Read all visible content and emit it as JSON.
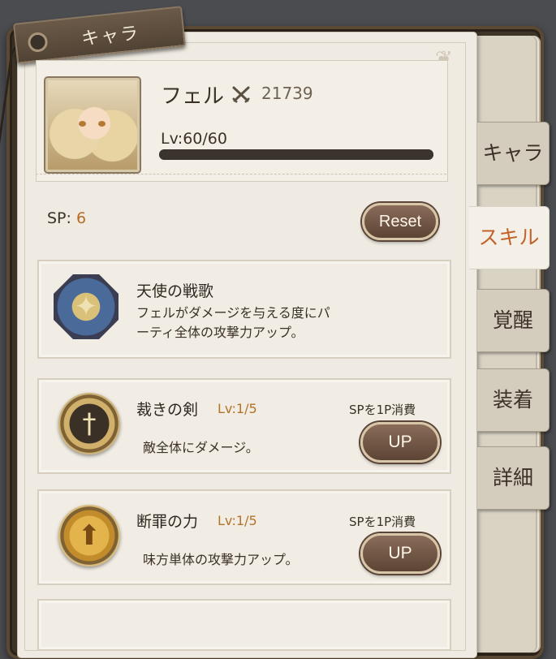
{
  "header": {
    "title": "キャラ"
  },
  "character": {
    "name": "フェル",
    "power": "21739",
    "level_text": "Lv:60/60",
    "level_progress": 1.0
  },
  "sp": {
    "label": "SP: ",
    "value": "6"
  },
  "reset_label": "Reset",
  "skills": [
    {
      "title": "天使の戦歌",
      "desc_line1": "フェルがダメージを与える度にパ",
      "desc_line2": "ーティ全体の攻撃力アップ。",
      "icon": "angel-song-icon"
    },
    {
      "title": "裁きの剣",
      "level": "Lv:1/5",
      "cost": "SPを1P消費",
      "desc": "敵全体にダメージ。",
      "button": "UP",
      "icon": "sword-emblem-icon"
    },
    {
      "title": "断罪の力",
      "level": "Lv:1/5",
      "cost": "SPを1P消費",
      "desc": "味方単体の攻撃力アップ。",
      "button": "UP",
      "icon": "arrow-up-emblem-icon"
    }
  ],
  "tabs": [
    "キャラ",
    "スキル",
    "覚醒",
    "装着",
    "詳細"
  ],
  "active_tab": "スキル",
  "colors": {
    "accent": "#c1632a",
    "level_text": "#b37229"
  }
}
